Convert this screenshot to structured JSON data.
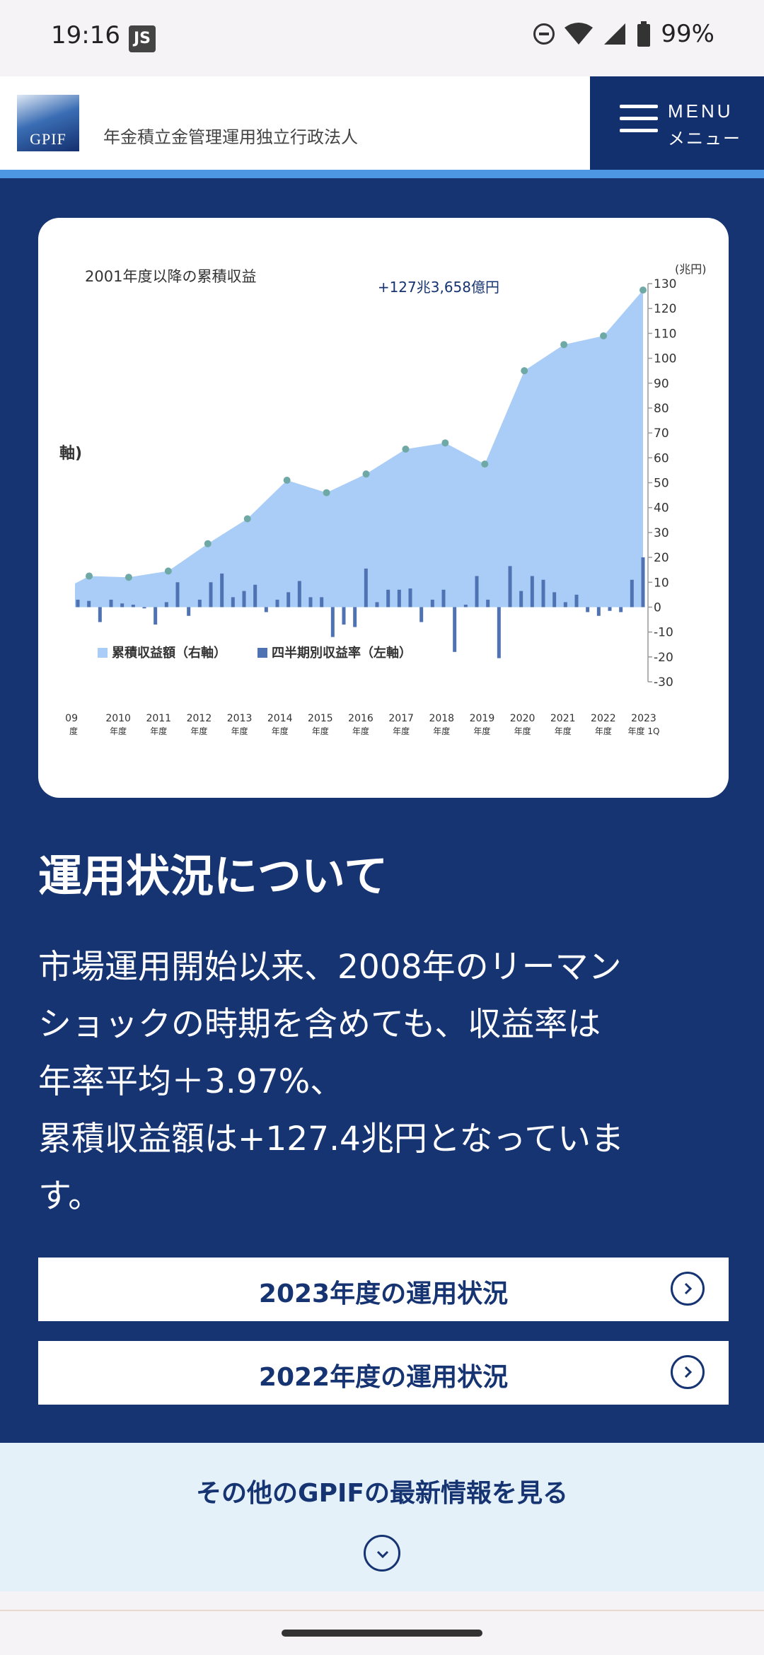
{
  "status_bar": {
    "time": "19:16",
    "battery": "99%",
    "app_icon_text": "JS"
  },
  "header": {
    "org_name": "年金積立金管理運用独立行政法人",
    "logo_text": "GPIF",
    "menu_en": "MENU",
    "menu_ja": "メニュー"
  },
  "chart_data": {
    "type": "area+bar",
    "title": "2001年度以降の累積収益",
    "annotation": "+127兆3,658億円",
    "y_unit": "(兆円)",
    "left_axis_fragment": "軸)",
    "ylim": [
      -30,
      130
    ],
    "y_ticks": [
      130,
      120,
      110,
      100,
      90,
      80,
      70,
      60,
      50,
      40,
      30,
      20,
      10,
      0,
      -10,
      -20,
      -30
    ],
    "x_tick_labels": [
      {
        "year": "09",
        "sub": "度"
      },
      {
        "year": "2010",
        "sub": "年度"
      },
      {
        "year": "2011",
        "sub": "年度"
      },
      {
        "year": "2012",
        "sub": "年度"
      },
      {
        "year": "2013",
        "sub": "年度"
      },
      {
        "year": "2014",
        "sub": "年度"
      },
      {
        "year": "2015",
        "sub": "年度"
      },
      {
        "year": "2016",
        "sub": "年度"
      },
      {
        "year": "2017",
        "sub": "年度"
      },
      {
        "year": "2018",
        "sub": "年度"
      },
      {
        "year": "2019",
        "sub": "年度"
      },
      {
        "year": "2020",
        "sub": "年度"
      },
      {
        "year": "2021",
        "sub": "年度"
      },
      {
        "year": "2022",
        "sub": "年度"
      },
      {
        "year": "2023",
        "sub": "年度 1Q"
      }
    ],
    "cumulative_series": {
      "name": "累積収益額（右軸）",
      "x": [
        "2009",
        "2010",
        "2011",
        "2012",
        "2013",
        "2014",
        "2015",
        "2016",
        "2017",
        "2018",
        "2019",
        "2020",
        "2021",
        "2022",
        "2023 1Q"
      ],
      "values": [
        12.5,
        12,
        14.5,
        25.5,
        35.5,
        51,
        46,
        53.5,
        63.5,
        66,
        57.5,
        95,
        105.5,
        109,
        127.4
      ]
    },
    "quarterly_series": {
      "name": "四半期別収益率（左軸）",
      "values": [
        3,
        2.5,
        -6,
        3,
        1.5,
        1,
        -0.5,
        -7,
        2,
        10,
        -3.5,
        3,
        10,
        13.5,
        4,
        6.5,
        9,
        -2,
        3,
        6,
        10.5,
        4,
        4,
        -12,
        -7,
        -8,
        15.5,
        2,
        7,
        7,
        7.5,
        -6,
        3,
        7,
        -18,
        1,
        12.5,
        3,
        -20.5,
        16.5,
        6.5,
        12.5,
        11,
        6,
        2,
        5,
        -2,
        -3.5,
        -1.5,
        -2,
        11,
        20
      ]
    },
    "legend": [
      "累積収益額（右軸）",
      "四半期別収益率（左軸）"
    ],
    "legend_position": "bottom-left",
    "colors": {
      "area": "#a9cdf6",
      "bars": "#4f73b2",
      "points": "#6fa9a6"
    }
  },
  "main": {
    "title": "運用状況について",
    "body_lines": [
      "市場運用開始以来、2008年のリーマン",
      "ショックの時期を含めても、収益率は",
      "年率平均＋3.97%、",
      "累積収益額は+127.4兆円となっていま",
      "す。"
    ],
    "buttons": [
      {
        "label": "2023年度の運用状況"
      },
      {
        "label": "2022年度の運用状況"
      }
    ]
  },
  "more": {
    "label": "その他のGPIFの最新情報を見る"
  },
  "colors": {
    "navy": "#163372",
    "stripe": "#4d96e3",
    "band": "#e4f1f9"
  }
}
